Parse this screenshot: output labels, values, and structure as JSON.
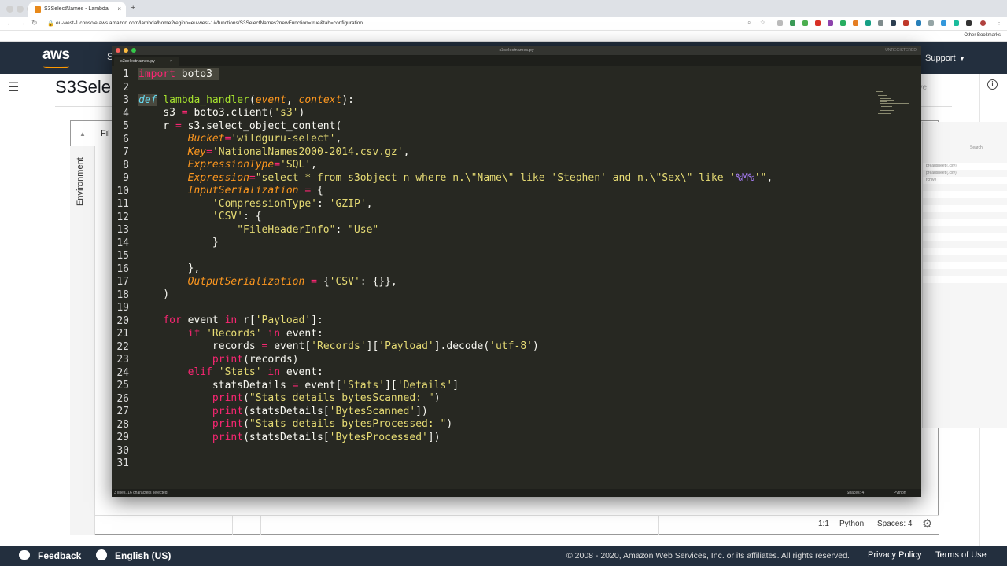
{
  "browser": {
    "tab_title": "S3SelectNames - Lambda",
    "tab_close": "×",
    "new_tab": "+",
    "url": "eu-west-1.console.aws.amazon.com/lambda/home?region=eu-west-1#/functions/S3SelectNames?newFunction=true&tab=configuration",
    "other_bookmarks": "Other Bookmarks"
  },
  "aws": {
    "logo": "aws",
    "nav_peek": "S",
    "support": "Support",
    "support_caret": "▼",
    "page_title": "S3Sele",
    "save_label": "ave",
    "info": "i"
  },
  "lambda_editor": {
    "env_label": "Environment",
    "file_peek": "Fil",
    "cursor_pos": "1:1",
    "language": "Python",
    "spaces": "Spaces: 4"
  },
  "background_app": {
    "search": "Search",
    "rows": [
      "preadsheet (.csv)",
      "preadsheet (.csv)",
      "rchive"
    ]
  },
  "sublime": {
    "window_title": "s3selectnames.py",
    "unregistered": "UNREGISTERED",
    "tab_label": "s3selectnames.py",
    "tab_close": "×",
    "status_left": "3 lines, 16 characters selected",
    "status_spaces": "Spaces: 4",
    "status_lang": "Python",
    "line_numbers": [
      "1",
      "2",
      "3",
      "4",
      "5",
      "6",
      "7",
      "8",
      "9",
      "10",
      "11",
      "12",
      "13",
      "14",
      "15",
      "16",
      "17",
      "18",
      "19",
      "20",
      "21",
      "22",
      "23",
      "24",
      "25",
      "26",
      "27",
      "28",
      "29",
      "30",
      "31"
    ],
    "code": {
      "l1": [
        "import",
        " boto3 "
      ],
      "l3": [
        "def",
        " ",
        "lambda_handler",
        "(",
        "event",
        ", ",
        "context",
        "):"
      ],
      "l4": [
        "    s3 ",
        "=",
        " boto3.client(",
        "'s3'",
        ")"
      ],
      "l5": [
        "    r ",
        "=",
        " s3.select_object_content("
      ],
      "l6": [
        "        ",
        "Bucket",
        "=",
        "'wildguru-select'",
        ","
      ],
      "l7": [
        "        ",
        "Key",
        "=",
        "'NationalNames2000-2014.csv.gz'",
        ","
      ],
      "l8": [
        "        ",
        "ExpressionType",
        "=",
        "'SQL'",
        ","
      ],
      "l9": [
        "        ",
        "Expression",
        "=",
        "\"select * from s3object n where n.\\\"Name\\\" like 'Stephen' and n.\\\"Sex\\\" like '",
        "%M%",
        "'\"",
        ","
      ],
      "l10": [
        "        ",
        "InputSerialization",
        " ",
        "=",
        " {"
      ],
      "l11": [
        "            ",
        "'CompressionType'",
        ": ",
        "'GZIP'",
        ","
      ],
      "l12": [
        "            ",
        "'CSV'",
        ": {"
      ],
      "l13": [
        "                ",
        "\"FileHeaderInfo\"",
        ": ",
        "\"Use\""
      ],
      "l14": [
        "            }"
      ],
      "l16": [
        "        },"
      ],
      "l17": [
        "        ",
        "OutputSerialization",
        " ",
        "=",
        " {",
        "'CSV'",
        ": {}},"
      ],
      "l18": [
        "    )"
      ],
      "l20": [
        "    ",
        "for",
        " event ",
        "in",
        " r[",
        "'Payload'",
        "]:"
      ],
      "l21": [
        "        ",
        "if",
        " ",
        "'Records'",
        " ",
        "in",
        " event:"
      ],
      "l22": [
        "            records ",
        "=",
        " event[",
        "'Records'",
        "][",
        "'Payload'",
        "].decode(",
        "'utf-8'",
        ")"
      ],
      "l23": [
        "            ",
        "print",
        "(records)"
      ],
      "l24": [
        "        ",
        "elif",
        " ",
        "'Stats'",
        " ",
        "in",
        " event:"
      ],
      "l25": [
        "            statsDetails ",
        "=",
        " event[",
        "'Stats'",
        "][",
        "'Details'",
        "]"
      ],
      "l26": [
        "            ",
        "print",
        "(",
        "\"Stats details bytesScanned: \"",
        ")"
      ],
      "l27": [
        "            ",
        "print",
        "(statsDetails[",
        "'BytesScanned'",
        "])"
      ],
      "l28": [
        "            ",
        "print",
        "(",
        "\"Stats details bytesProcessed: \"",
        ")"
      ],
      "l29": [
        "            ",
        "print",
        "(statsDetails[",
        "'BytesProcessed'",
        "])"
      ]
    }
  },
  "footer": {
    "feedback": "Feedback",
    "language": "English (US)",
    "copyright": "© 2008 - 2020, Amazon Web Services, Inc. or its affiliates. All rights reserved.",
    "privacy": "Privacy Policy",
    "terms": "Terms of Use"
  },
  "colors": {
    "aws_nav": "#232f3e",
    "aws_orange": "#ff9900",
    "editor_bg": "#272822",
    "keyword": "#f92672",
    "string": "#e6db74",
    "function": "#a6e22e",
    "param": "#fd971f",
    "builtin": "#66d9ef"
  }
}
